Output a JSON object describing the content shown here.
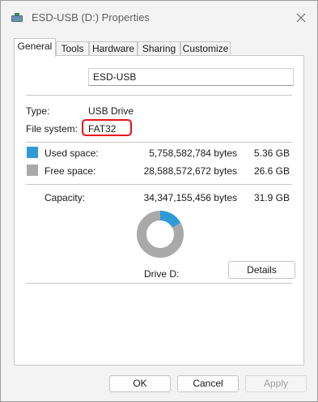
{
  "window": {
    "title": "ESD-USB (D:) Properties",
    "drive_icon": "usb-drive-icon",
    "close_icon": "close-icon"
  },
  "tabs": [
    {
      "label": "General",
      "active": true
    },
    {
      "label": "Tools",
      "active": false
    },
    {
      "label": "Hardware",
      "active": false
    },
    {
      "label": "Sharing",
      "active": false
    },
    {
      "label": "Customize",
      "active": false
    }
  ],
  "general": {
    "drive_label": "ESD-USB",
    "type_label": "Type:",
    "type_value": "USB Drive",
    "fs_label": "File system:",
    "fs_value": "FAT32",
    "used_label": "Used space:",
    "used_bytes": "5,758,582,784 bytes",
    "used_size": "5.36 GB",
    "free_label": "Free space:",
    "free_bytes": "28,588,572,672 bytes",
    "free_size": "26.6 GB",
    "capacity_label": "Capacity:",
    "capacity_bytes": "34,347,155,456 bytes",
    "capacity_size": "31.9 GB",
    "drive_caption": "Drive D:",
    "details_label": "Details",
    "used_fraction": 0.1677
  },
  "colors": {
    "used": "#2e9bd6",
    "free": "#a9a9a9",
    "highlight": "#e8101a"
  },
  "footer": {
    "ok_label": "OK",
    "cancel_label": "Cancel",
    "apply_label": "Apply"
  }
}
